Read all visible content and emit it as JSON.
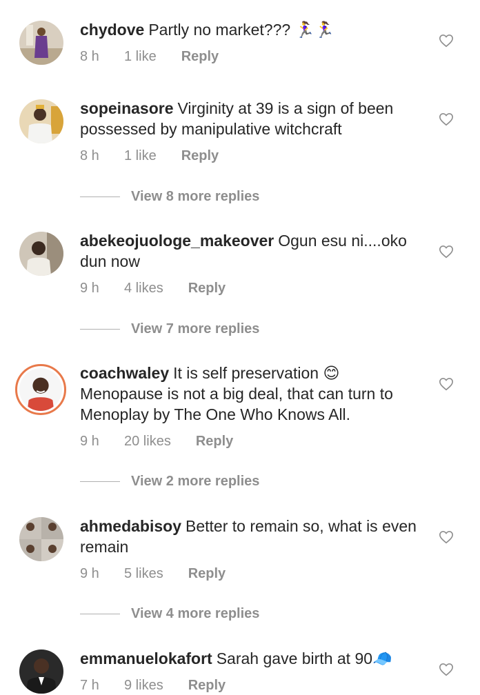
{
  "comments": [
    {
      "username": "chydove",
      "text": "Partly no market??? 🏃‍♀️🏃‍♀️",
      "time": "8 h",
      "likes": "1 like",
      "reply": "Reply",
      "view_more": ""
    },
    {
      "username": "sopeinasore",
      "text": "Virginity at 39 is a sign of been possessed by manipulative witchcraft",
      "time": "8 h",
      "likes": "1 like",
      "reply": "Reply",
      "view_more": "View 8 more replies"
    },
    {
      "username": "abekeojuologe_makeover",
      "text": "Ogun esu ni....oko dun now",
      "time": "9 h",
      "likes": "4 likes",
      "reply": "Reply",
      "view_more": "View 7 more replies"
    },
    {
      "username": "coachwaley",
      "text": "It is self preservation 😊 Menopause is not a big deal, that can turn to Menoplay by The One Who Knows All.",
      "time": "9 h",
      "likes": "20 likes",
      "reply": "Reply",
      "view_more": "View 2 more replies"
    },
    {
      "username": "ahmedabisoy",
      "text": "Better to remain so, what is even remain",
      "time": "9 h",
      "likes": "5 likes",
      "reply": "Reply",
      "view_more": "View 4 more replies"
    },
    {
      "username": "emmanuelokafort",
      "text": "Sarah gave birth at 90🧢",
      "time": "7 h",
      "likes": "9 likes",
      "reply": "Reply",
      "view_more": ""
    }
  ],
  "colors": {
    "text": "#262626",
    "secondary": "#8e8e8e",
    "story_ring": "#e8794a"
  },
  "icons": {
    "like": "heart-outline-icon"
  }
}
